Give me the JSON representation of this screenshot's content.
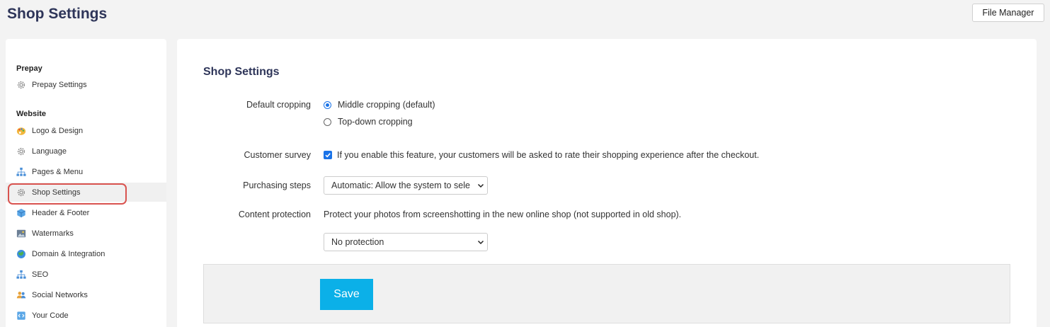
{
  "header": {
    "title": "Shop Settings",
    "file_manager_label": "File Manager"
  },
  "sidebar": {
    "sections": [
      {
        "heading": "Prepay",
        "items": [
          {
            "label": "Prepay Settings",
            "icon": "gear-icon"
          }
        ]
      },
      {
        "heading": "Website",
        "items": [
          {
            "label": "Logo & Design",
            "icon": "palette-icon"
          },
          {
            "label": "Language",
            "icon": "gear-icon"
          },
          {
            "label": "Pages & Menu",
            "icon": "sitemap-icon"
          },
          {
            "label": "Shop Settings",
            "icon": "gear-icon",
            "active": true
          },
          {
            "label": "Header & Footer",
            "icon": "cube-icon"
          },
          {
            "label": "Watermarks",
            "icon": "image-icon"
          },
          {
            "label": "Domain & Integration",
            "icon": "globe-icon"
          },
          {
            "label": "SEO",
            "icon": "sitemap-icon"
          },
          {
            "label": "Social Networks",
            "icon": "users-icon"
          },
          {
            "label": "Your Code",
            "icon": "code-file-icon"
          }
        ]
      }
    ]
  },
  "main": {
    "title": "Shop Settings",
    "default_cropping": {
      "label": "Default cropping",
      "options": [
        {
          "label": "Middle cropping (default)",
          "selected": true
        },
        {
          "label": "Top-down cropping",
          "selected": false
        }
      ]
    },
    "customer_survey": {
      "label": "Customer survey",
      "checked": true,
      "text": "If you enable this feature, your customers will be asked to rate their shopping experience after the checkout."
    },
    "purchasing_steps": {
      "label": "Purchasing steps",
      "value": "Automatic: Allow the system to sele"
    },
    "content_protection": {
      "label": "Content protection",
      "description": "Protect your photos from screenshotting in the new online shop (not supported in old shop).",
      "value": "No protection"
    },
    "save_label": "Save"
  },
  "colors": {
    "title": "#2e3559",
    "accent": "#1a73e8",
    "save_button": "#0bb0e8",
    "highlight": "#d9534f"
  }
}
